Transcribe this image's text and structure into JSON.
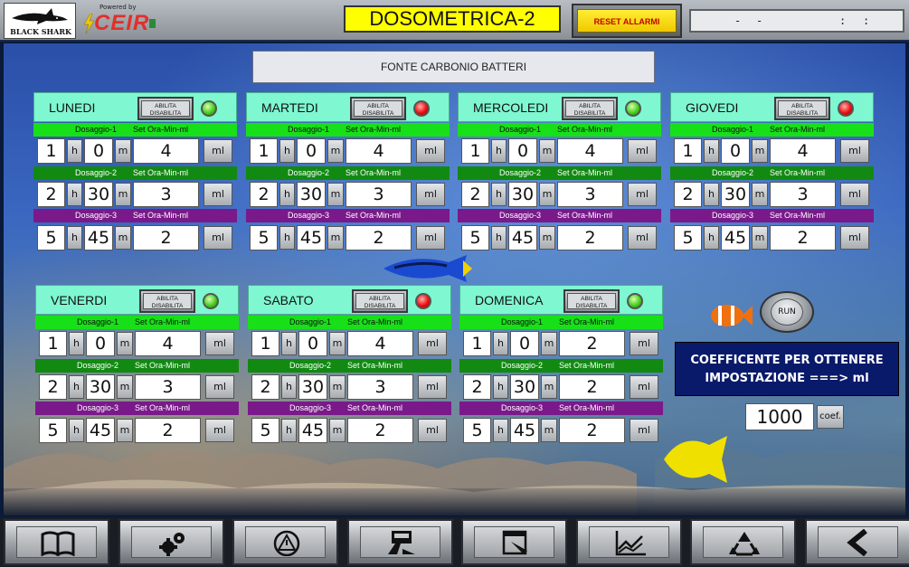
{
  "header": {
    "logo_text": "BLACK SHARK",
    "powered_by": "Powered by",
    "ceir_name": "CEIR",
    "title": "DOSOMETRICA-2",
    "reset_label": "RESET ALLARMI",
    "datetime": {
      "d1": "-",
      "d2": "-",
      "c1": ":",
      "c2": ":"
    }
  },
  "banner": "FONTE CARBONIO BATTERI",
  "labels": {
    "enable": "ABILITA DISABILITA",
    "set": "Set Ora-Min-ml",
    "dos1": "Dosaggio-1",
    "dos2": "Dosaggio-2",
    "dos3": "Dosaggio-3",
    "h": "h",
    "m": "m",
    "ml": "ml"
  },
  "days": [
    {
      "name": "LUNEDI",
      "led": "green",
      "doses": [
        {
          "h": "1",
          "m": "0",
          "ml": "4"
        },
        {
          "h": "2",
          "m": "30",
          "ml": "3"
        },
        {
          "h": "5",
          "m": "45",
          "ml": "2"
        }
      ]
    },
    {
      "name": "MARTEDI",
      "led": "red",
      "doses": [
        {
          "h": "1",
          "m": "0",
          "ml": "4"
        },
        {
          "h": "2",
          "m": "30",
          "ml": "3"
        },
        {
          "h": "5",
          "m": "45",
          "ml": "2"
        }
      ]
    },
    {
      "name": "MERCOLEDI",
      "led": "green",
      "doses": [
        {
          "h": "1",
          "m": "0",
          "ml": "4"
        },
        {
          "h": "2",
          "m": "30",
          "ml": "3"
        },
        {
          "h": "5",
          "m": "45",
          "ml": "2"
        }
      ]
    },
    {
      "name": "GIOVEDI",
      "led": "red",
      "doses": [
        {
          "h": "1",
          "m": "0",
          "ml": "4"
        },
        {
          "h": "2",
          "m": "30",
          "ml": "3"
        },
        {
          "h": "5",
          "m": "45",
          "ml": "2"
        }
      ]
    },
    {
      "name": "VENERDI",
      "led": "green",
      "doses": [
        {
          "h": "1",
          "m": "0",
          "ml": "4"
        },
        {
          "h": "2",
          "m": "30",
          "ml": "3"
        },
        {
          "h": "5",
          "m": "45",
          "ml": "2"
        }
      ]
    },
    {
      "name": "SABATO",
      "led": "red",
      "doses": [
        {
          "h": "1",
          "m": "0",
          "ml": "4"
        },
        {
          "h": "2",
          "m": "30",
          "ml": "3"
        },
        {
          "h": "5",
          "m": "45",
          "ml": "2"
        }
      ]
    },
    {
      "name": "DOMENICA",
      "led": "green",
      "doses": [
        {
          "h": "1",
          "m": "0",
          "ml": "2"
        },
        {
          "h": "2",
          "m": "30",
          "ml": "2"
        },
        {
          "h": "5",
          "m": "45",
          "ml": "2"
        }
      ]
    }
  ],
  "run_label": "RUN",
  "coef": {
    "line1": "COEFFICENTE PER OTTENERE",
    "line2": "IMPOSTAZIONE ===> ml",
    "value": "1000",
    "unit": "coef."
  },
  "nav": [
    {
      "icon": "book-icon"
    },
    {
      "icon": "gears-icon"
    },
    {
      "icon": "alarm-warning-icon"
    },
    {
      "icon": "dosing-pump-icon"
    },
    {
      "icon": "document-edit-icon"
    },
    {
      "icon": "chart-trend-icon"
    },
    {
      "icon": "recycle-icon"
    },
    {
      "icon": "back-arrow-icon"
    }
  ]
}
